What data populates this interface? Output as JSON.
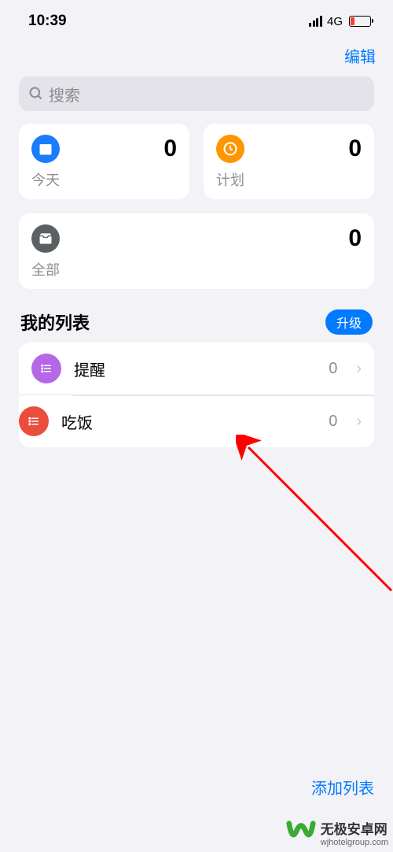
{
  "status": {
    "time": "10:39",
    "network": "4G"
  },
  "header": {
    "edit": "编辑"
  },
  "search": {
    "placeholder": "搜索"
  },
  "cards": {
    "today": {
      "label": "今天",
      "count": "0"
    },
    "scheduled": {
      "label": "计划",
      "count": "0"
    },
    "all": {
      "label": "全部",
      "count": "0"
    }
  },
  "section": {
    "title": "我的列表",
    "upgrade": "升级"
  },
  "lists": [
    {
      "name": "提醒",
      "count": "0",
      "color": "purple"
    },
    {
      "name": "吃饭",
      "count": "0",
      "color": "red"
    }
  ],
  "footer": {
    "add_list": "添加列表"
  },
  "watermark": {
    "name": "无极安卓网",
    "url": "wjhotelgroup.com"
  }
}
